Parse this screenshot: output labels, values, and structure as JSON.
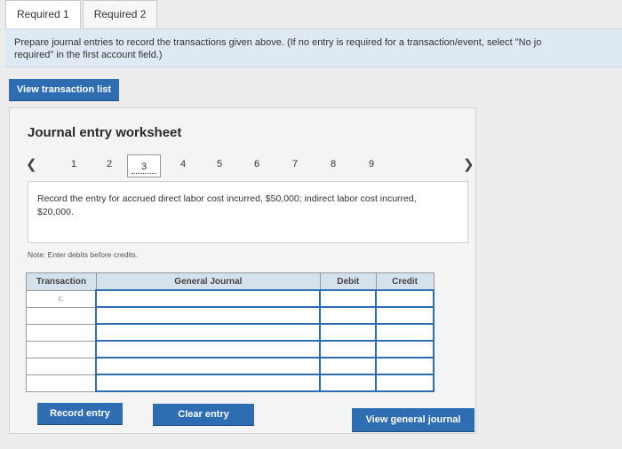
{
  "tabs": [
    {
      "label": "Required 1"
    },
    {
      "label": "Required 2"
    }
  ],
  "instructions": "Prepare journal entries to record the transactions given above. (If no entry is required for a transaction/event, select \"No jo",
  "instructions_line2": "required\" in the first account field.)",
  "view_transaction_list": "View transaction list",
  "worksheet": {
    "title": "Journal entry worksheet",
    "pages": [
      "1",
      "2",
      "3",
      "4",
      "5",
      "6",
      "7",
      "8",
      "9"
    ],
    "current_page": "3",
    "prompt": "Record the entry for accrued direct labor cost incurred, $50,000; indirect labor cost incurred, $20,000.",
    "note": "Note: Enter debits before credits.",
    "table": {
      "headers": {
        "transaction": "Transaction",
        "general_journal": "General Journal",
        "debit": "Debit",
        "credit": "Credit"
      },
      "transaction_label": "c."
    }
  },
  "buttons": {
    "record_entry": "Record entry",
    "clear_entry": "Clear entry",
    "view_general_journal": "View general journal"
  }
}
